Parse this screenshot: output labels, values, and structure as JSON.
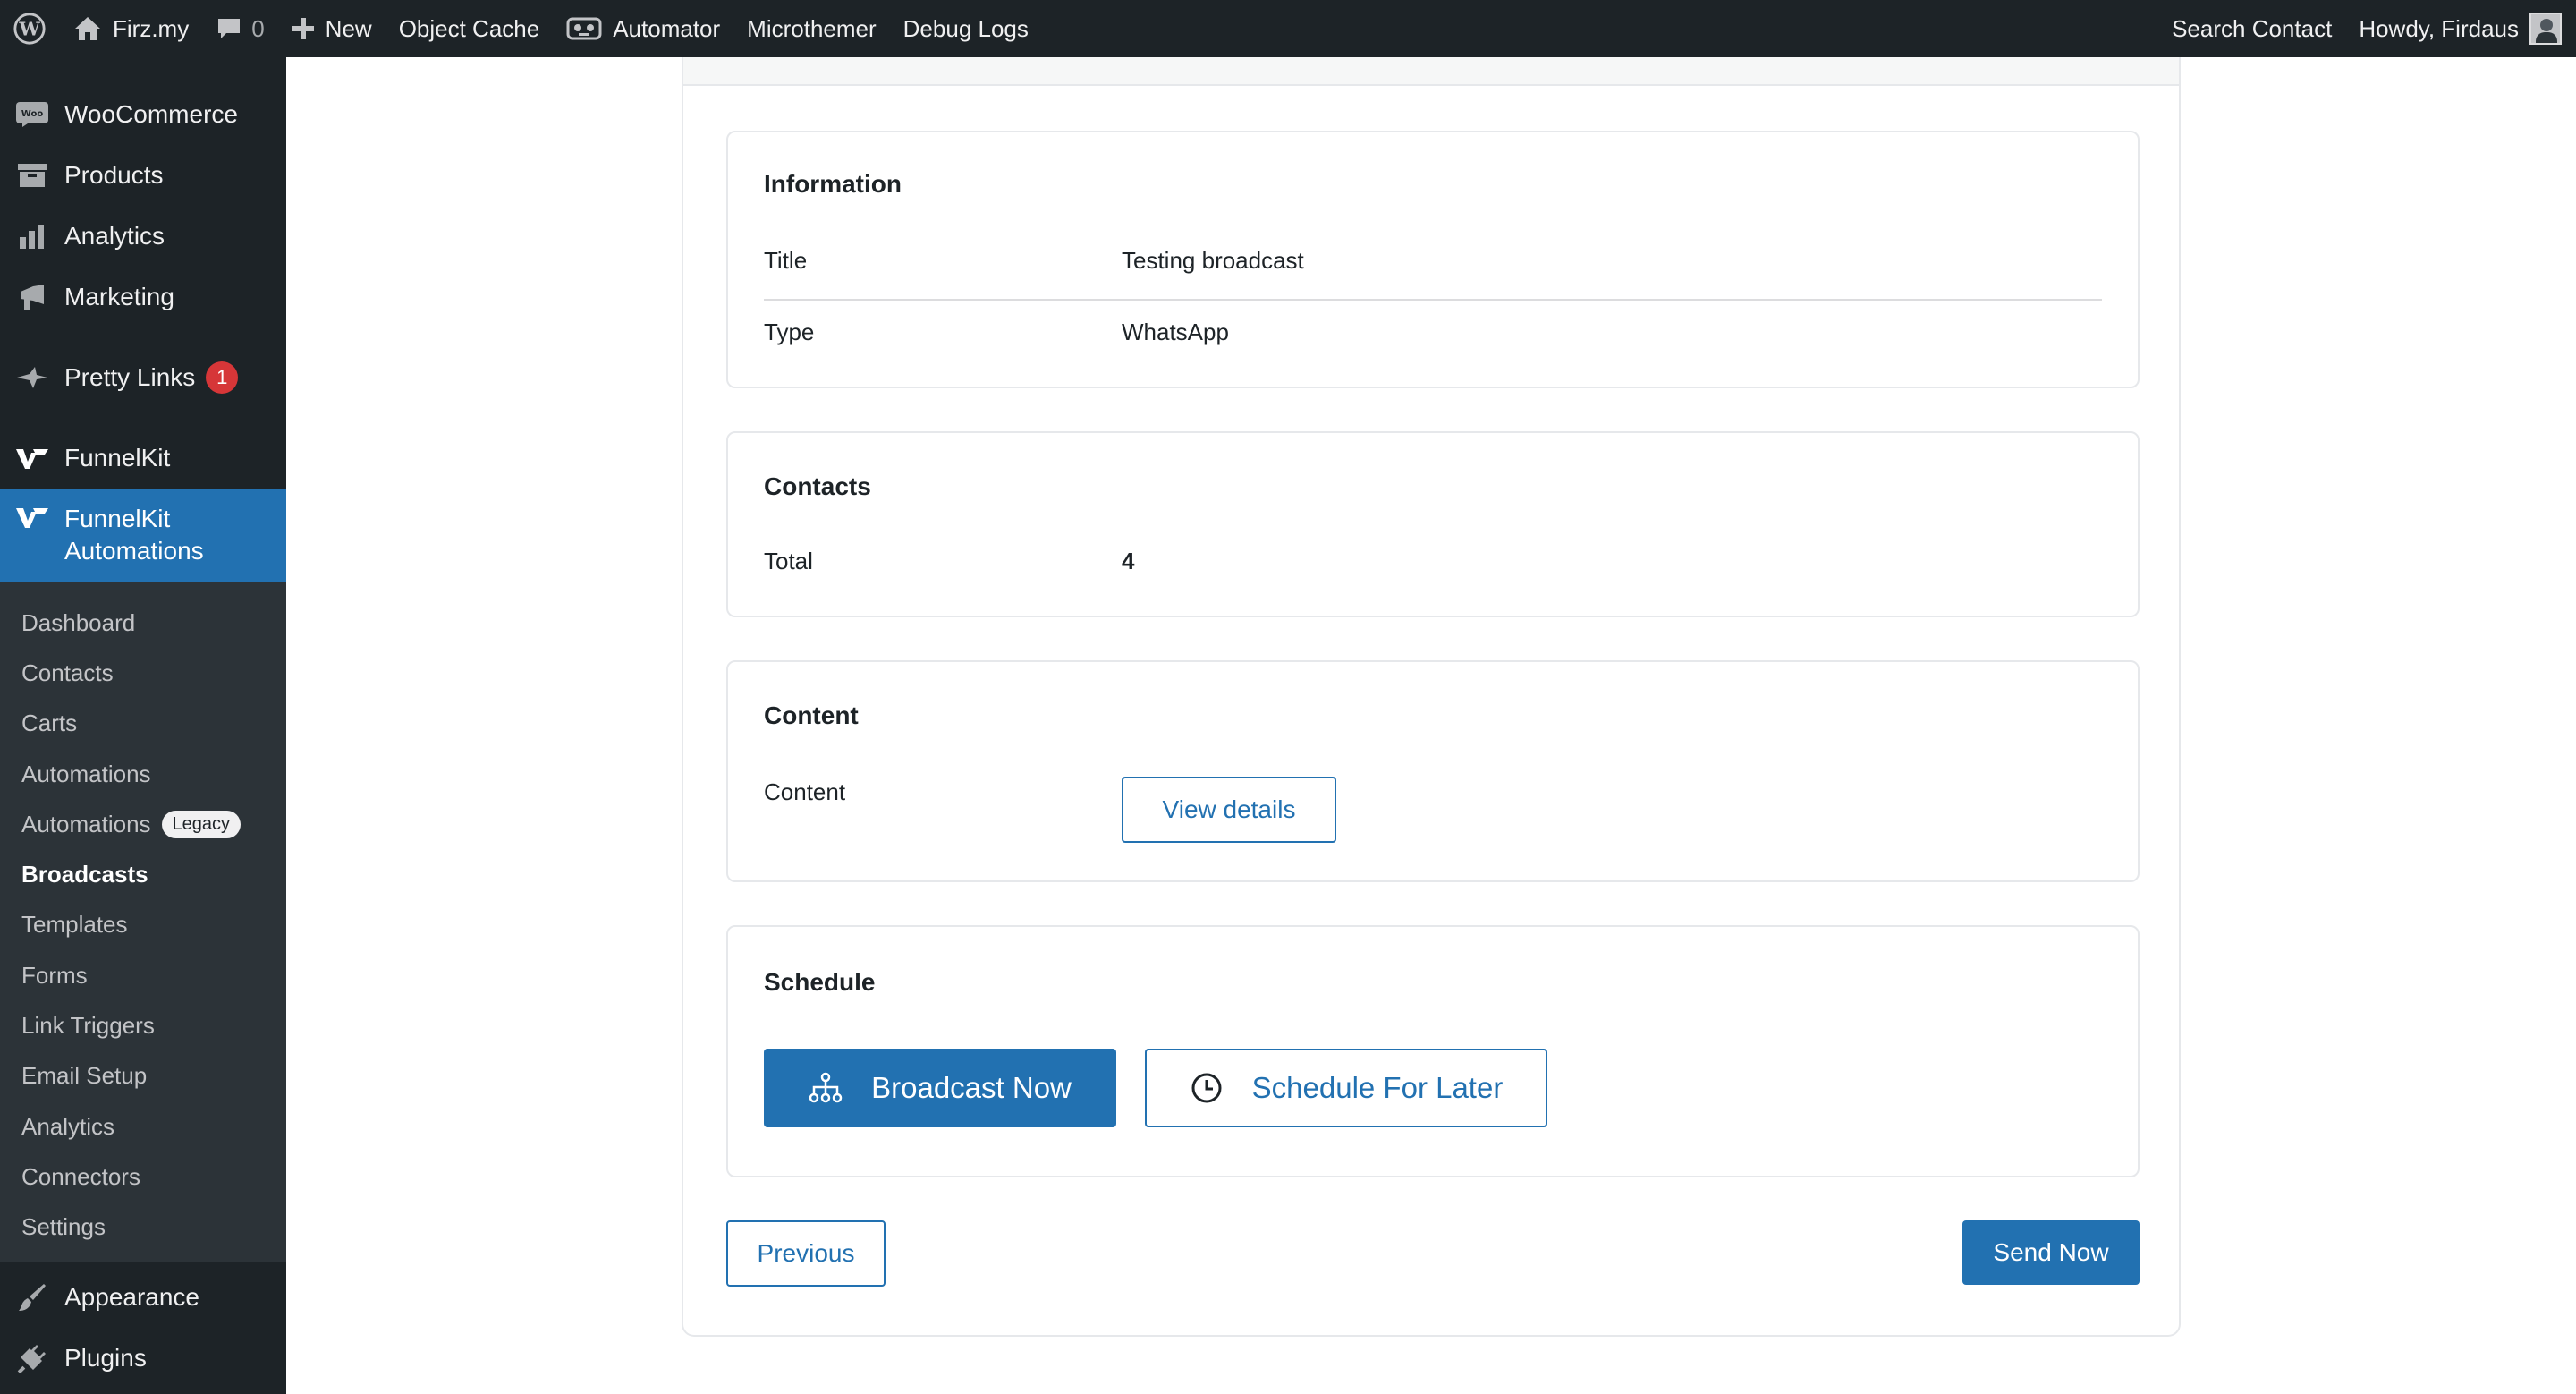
{
  "admin_bar": {
    "site_name": "Firz.my",
    "comments_count": "0",
    "new_label": "New",
    "object_cache_label": "Object Cache",
    "automator_label": "Automator",
    "microthemer_label": "Microthemer",
    "debug_logs_label": "Debug Logs",
    "search_contact_label": "Search Contact",
    "howdy_label": "Howdy, Firdaus"
  },
  "sidebar": {
    "woocommerce": "WooCommerce",
    "woocommerce_icon_text": "Woo",
    "products": "Products",
    "analytics": "Analytics",
    "marketing": "Marketing",
    "pretty_links": "Pretty Links",
    "pretty_links_badge": "1",
    "funnelkit": "FunnelKit",
    "funnelkit_automations_line1": "FunnelKit",
    "funnelkit_automations_line2": "Automations",
    "submenu": {
      "dashboard": "Dashboard",
      "contacts": "Contacts",
      "carts": "Carts",
      "automations": "Automations",
      "automations_legacy": "Automations",
      "legacy_badge": "Legacy",
      "broadcasts": "Broadcasts",
      "templates": "Templates",
      "forms": "Forms",
      "link_triggers": "Link Triggers",
      "email_setup": "Email Setup",
      "analytics": "Analytics",
      "connectors": "Connectors",
      "settings": "Settings"
    },
    "appearance": "Appearance",
    "plugins": "Plugins"
  },
  "information": {
    "heading": "Information",
    "title_label": "Title",
    "title_value": "Testing broadcast",
    "type_label": "Type",
    "type_value": "WhatsApp"
  },
  "contacts": {
    "heading": "Contacts",
    "total_label": "Total",
    "total_value": "4"
  },
  "content": {
    "heading": "Content",
    "content_label": "Content",
    "view_details_label": "View details"
  },
  "schedule": {
    "heading": "Schedule",
    "broadcast_now_label": "Broadcast Now",
    "schedule_later_label": "Schedule For Later"
  },
  "footer": {
    "previous_label": "Previous",
    "send_now_label": "Send Now"
  },
  "colors": {
    "admin_bg": "#1d2327",
    "submenu_bg": "#2c3338",
    "accent": "#2271b1",
    "badge_red": "#d63638"
  }
}
